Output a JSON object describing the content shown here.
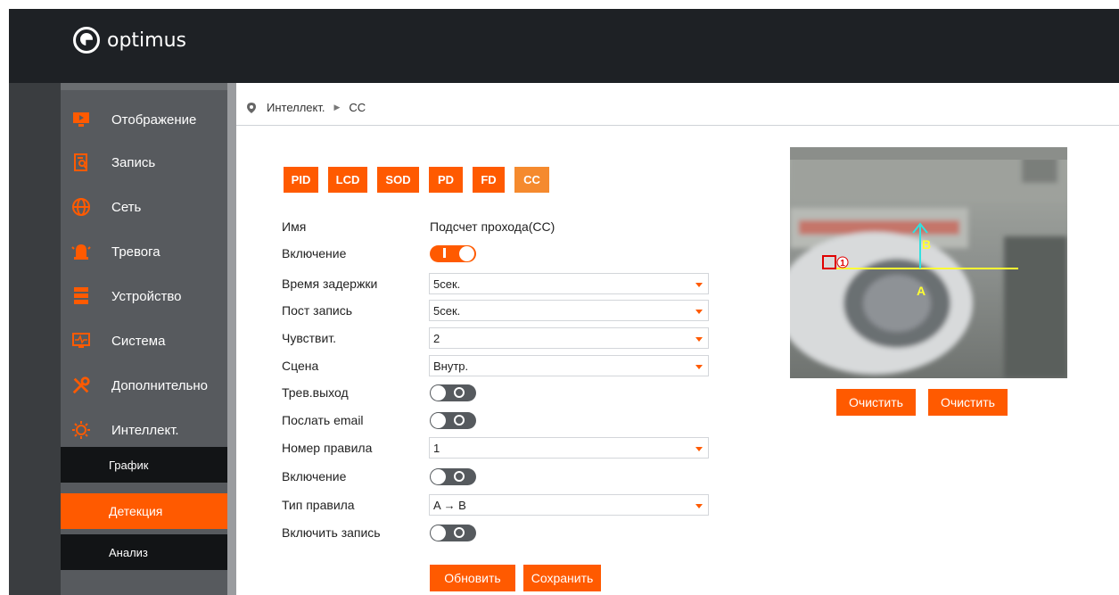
{
  "brand": {
    "name": "optimus"
  },
  "sidebar": {
    "items": [
      {
        "label": "Отображение",
        "icon": "monitor-play-icon"
      },
      {
        "label": "Запись",
        "icon": "file-search-icon"
      },
      {
        "label": "Сеть",
        "icon": "globe-icon"
      },
      {
        "label": "Тревога",
        "icon": "alarm-bell-icon"
      },
      {
        "label": "Устройство",
        "icon": "server-icon"
      },
      {
        "label": "Система",
        "icon": "system-monitor-icon"
      },
      {
        "label": "Дополнительно",
        "icon": "tools-icon"
      },
      {
        "label": "Интеллект.",
        "icon": "intelligence-icon"
      }
    ],
    "subitems": [
      {
        "label": "График"
      },
      {
        "label": "Детекция",
        "active": true
      },
      {
        "label": "Анализ"
      }
    ]
  },
  "breadcrumb": {
    "first": "Интеллект.",
    "second": "CC"
  },
  "tabs": [
    {
      "label": "PID"
    },
    {
      "label": "LCD"
    },
    {
      "label": "SOD"
    },
    {
      "label": "PD"
    },
    {
      "label": "FD"
    },
    {
      "label": "CC",
      "selected": true
    }
  ],
  "form": {
    "name_label": "Имя",
    "name_value": "Подсчет прохода(CC)",
    "enable_label": "Включение",
    "delay_label": "Время задержки",
    "delay_value": "5сек.",
    "post_label": "Пост запись",
    "post_value": "5сек.",
    "sens_label": "Чувствит.",
    "sens_value": "2",
    "scene_label": "Сцена",
    "scene_value": "Внутр.",
    "alarm_out_label": "Трев.выход",
    "email_label": "Послать email",
    "rule_no_label": "Номер правила",
    "rule_no_value": "1",
    "rule_enable_label": "Включение",
    "rule_type_label": "Тип правила",
    "rule_type_value": "A → B",
    "record_label": "Включить запись"
  },
  "toggles": {
    "enable": true,
    "alarm_out": false,
    "email": false,
    "rule_enable": false,
    "record": false
  },
  "buttons": {
    "refresh": "Обновить",
    "save": "Сохранить",
    "clear1": "Очистить",
    "clear2": "Очистить"
  },
  "preview": {
    "label_a": "A",
    "label_b": "B",
    "rule_number": "1",
    "line_color": "#ffff33",
    "arrow_color": "#33e0e0",
    "marker_color": "#e00000"
  },
  "colors": {
    "accent": "#ff5a00",
    "accent_selected": "#f58a2e"
  }
}
